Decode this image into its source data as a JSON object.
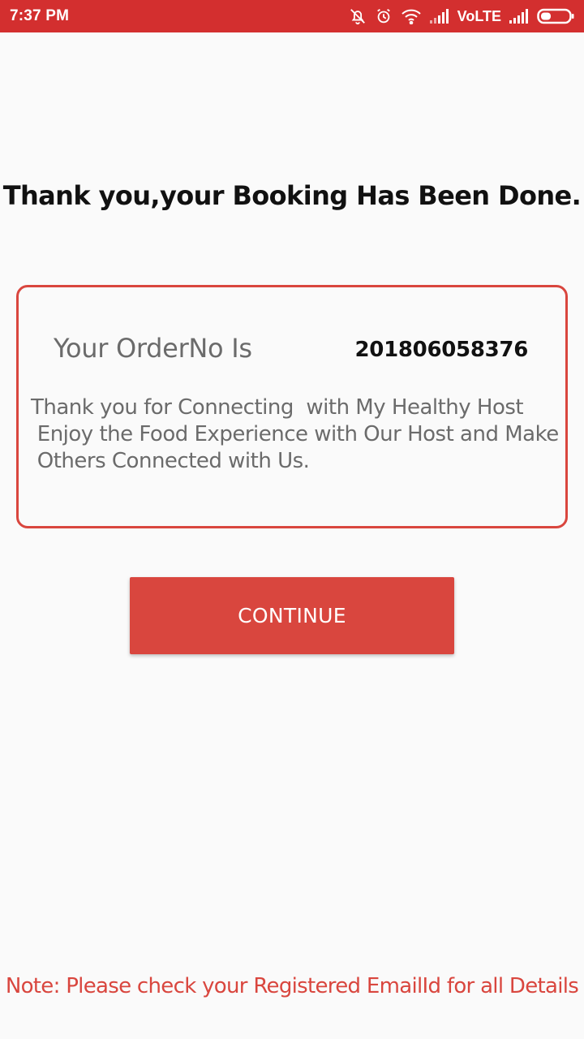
{
  "status_bar": {
    "time": "7:37 PM",
    "network_label": "VoLTE",
    "icons": [
      "bell-off-icon",
      "alarm-icon",
      "wifi-icon",
      "signal-icon",
      "signal-icon",
      "battery-icon"
    ],
    "background_color": "#d32f2f"
  },
  "confirmation": {
    "title": "Thank you,your Booking Has Been Done."
  },
  "order_card": {
    "order_label": "Your OrderNo Is",
    "order_number": "201806058376",
    "message": "Thank you for Connecting  with My Healthy Host\n Enjoy the Food Experience with Our Host and Make\n Others Connected with Us.",
    "border_color": "#d9463e"
  },
  "actions": {
    "continue_label": "CONTINUE",
    "accent_color": "#d9463e"
  },
  "footer": {
    "note": "Note: Please check your Registered EmailId for all Details"
  }
}
